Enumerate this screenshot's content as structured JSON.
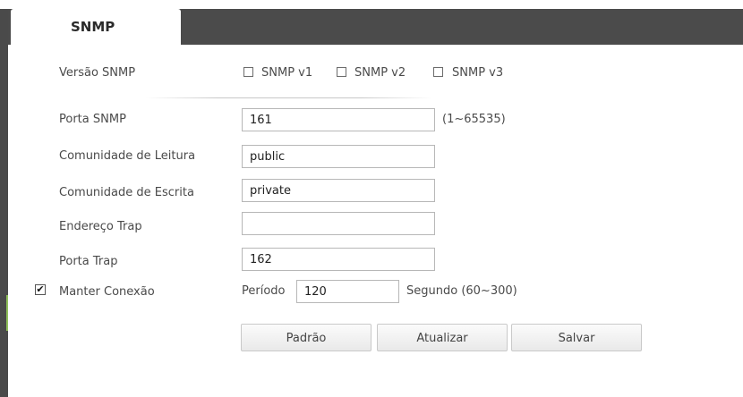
{
  "tab": {
    "label": "SNMP"
  },
  "version": {
    "label": "Versão SNMP",
    "options": [
      {
        "label": "SNMP v1",
        "checked": false
      },
      {
        "label": "SNMP v2",
        "checked": false
      },
      {
        "label": "SNMP v3",
        "checked": false
      }
    ]
  },
  "port": {
    "label": "Porta SNMP",
    "value": "161",
    "range": "(1~65535)"
  },
  "read_community": {
    "label": "Comunidade de Leitura",
    "value": "public"
  },
  "write_community": {
    "label": "Comunidade de Escrita",
    "value": "private"
  },
  "trap_address": {
    "label": "Endereço Trap",
    "value": ""
  },
  "trap_port": {
    "label": "Porta Trap",
    "value": "162"
  },
  "keepalive": {
    "label": "Manter Conexão",
    "checked": true,
    "check_mark": "✔",
    "period_label": "Período",
    "period_value": "120",
    "unit": "Segundo (60~300)"
  },
  "buttons": {
    "default": "Padrão",
    "refresh": "Atualizar",
    "save": "Salvar"
  },
  "colors": {
    "header_bar": "#4b4b4b",
    "accent": "#8fbf5a"
  }
}
